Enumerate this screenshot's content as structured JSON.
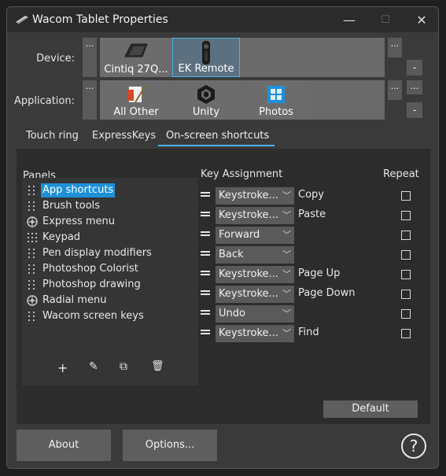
{
  "window": {
    "title": "Wacom Tablet Properties",
    "minimize_glyph": "—",
    "maximize_glyph": "☐",
    "close_glyph": "✕"
  },
  "device": {
    "label": "Device:",
    "more_glyph": "...",
    "remove_glyph": "-",
    "items": [
      {
        "label": "Cintiq 27Q...",
        "icon": "display-tablet-icon",
        "selected": false
      },
      {
        "label": "EK Remote",
        "icon": "remote-icon",
        "selected": true
      }
    ]
  },
  "application": {
    "label": "Application:",
    "more_glyph": "...",
    "remove_glyph": "-",
    "items": [
      {
        "label": "All Other",
        "icon": "all-other-apps-icon",
        "selected": false
      },
      {
        "label": "Unity",
        "icon": "unity-icon",
        "selected": false
      },
      {
        "label": "Photos",
        "icon": "photos-icon",
        "selected": false
      }
    ]
  },
  "tabs": [
    {
      "label": "Touch ring",
      "active": false
    },
    {
      "label": "ExpressKeys",
      "active": false
    },
    {
      "label": "On-screen shortcuts",
      "active": true
    }
  ],
  "panels": {
    "heading": "Panels",
    "items": [
      {
        "label": "App shortcuts",
        "icon": "grid-dots-icon",
        "selected": true
      },
      {
        "label": "Brush tools",
        "icon": "grid-dots-icon",
        "selected": false
      },
      {
        "label": "Express menu",
        "icon": "radial-wheel-icon",
        "selected": false
      },
      {
        "label": "Keypad",
        "icon": "keypad-dots-icon",
        "selected": false
      },
      {
        "label": "Pen display modifiers",
        "icon": "grid-dots-icon",
        "selected": false
      },
      {
        "label": "Photoshop Colorist",
        "icon": "grid-dots-icon",
        "selected": false
      },
      {
        "label": "Photoshop drawing",
        "icon": "grid-dots-icon",
        "selected": false
      },
      {
        "label": "Radial menu",
        "icon": "radial-wheel-icon",
        "selected": false
      },
      {
        "label": "Wacom screen keys",
        "icon": "grid-dots-icon",
        "selected": false
      }
    ],
    "tools": [
      {
        "name": "add-icon",
        "glyph": "+"
      },
      {
        "name": "edit-icon",
        "glyph": "✎"
      },
      {
        "name": "duplicate-icon",
        "glyph": "⧉"
      },
      {
        "name": "delete-icon",
        "glyph": "🗑"
      }
    ]
  },
  "key_assignment": {
    "heading": "Key Assignment",
    "repeat_heading": "Repeat",
    "rows": [
      {
        "function": "Keystroke...",
        "label": "Copy",
        "repeat": false
      },
      {
        "function": "Keystroke...",
        "label": "Paste",
        "repeat": false
      },
      {
        "function": "Forward",
        "label": "",
        "repeat": false
      },
      {
        "function": "Back",
        "label": "",
        "repeat": false
      },
      {
        "function": "Keystroke...",
        "label": "Page Up",
        "repeat": false
      },
      {
        "function": "Keystroke...",
        "label": "Page Down",
        "repeat": false
      },
      {
        "function": "Undo",
        "label": "",
        "repeat": false
      },
      {
        "function": "Keystroke...",
        "label": "Find",
        "repeat": false
      }
    ],
    "default_label": "Default"
  },
  "footer": {
    "about_label": "About",
    "options_label": "Options...",
    "help_glyph": "?"
  }
}
